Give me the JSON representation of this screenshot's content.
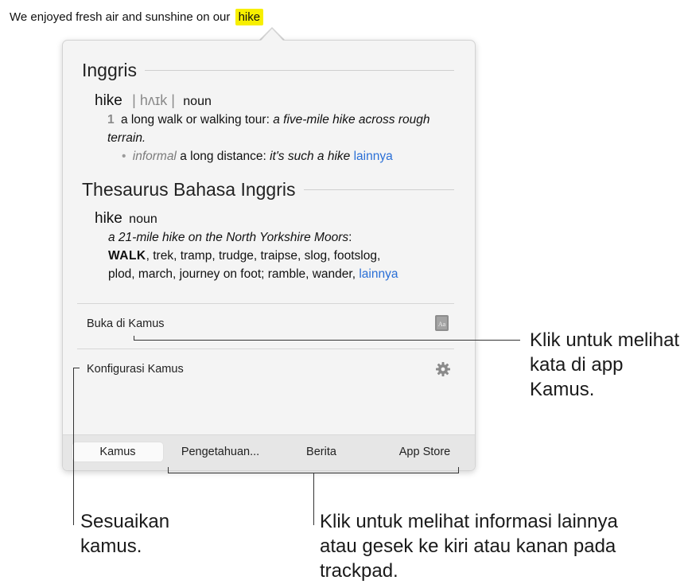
{
  "sentence": {
    "text": "We enjoyed fresh air and sunshine on our",
    "highlight": "hike"
  },
  "dictionary": {
    "heading": "Inggris",
    "headword": "hike",
    "pronunciation": "| hʌɪk |",
    "pos": "noun",
    "sense_number": "1",
    "sense_text": "a long walk or walking tour:",
    "sense_example": "a five-mile hike across rough terrain.",
    "sub_label": "informal",
    "sub_text": "a long distance:",
    "sub_example": "it's such a hike",
    "more_link": "lainnya"
  },
  "thesaurus": {
    "heading": "Thesaurus Bahasa Inggris",
    "headword": "hike",
    "pos": "noun",
    "example": "a 21-mile hike on the North Yorkshire Moors",
    "example_colon": ":",
    "core": "WALK",
    "synonyms_line1": ", trek, tramp, trudge, traipse, slog, footslog,",
    "synonyms_line2": "plod, march, journey on foot; ramble, wander,",
    "more_link": "lainnya"
  },
  "actions": {
    "open_dictionary": "Buka di Kamus",
    "configure": "Konfigurasi Kamus"
  },
  "tabs": [
    {
      "label": "Kamus",
      "active": true
    },
    {
      "label": "Pengetahuan...",
      "active": false
    },
    {
      "label": "Berita",
      "active": false
    },
    {
      "label": "App Store",
      "active": false
    }
  ],
  "callouts": {
    "open": "Klik untuk melihat kata di app Kamus.",
    "customize": "Sesuaikan kamus.",
    "more_info": "Klik untuk melihat informasi lainnya atau gesek ke kiri atau kanan pada trackpad."
  },
  "colors": {
    "highlight": "#f7ef00",
    "link": "#2a6fd6"
  },
  "icons": {
    "dictionary": "dictionary-book-icon",
    "settings": "gear-icon"
  }
}
